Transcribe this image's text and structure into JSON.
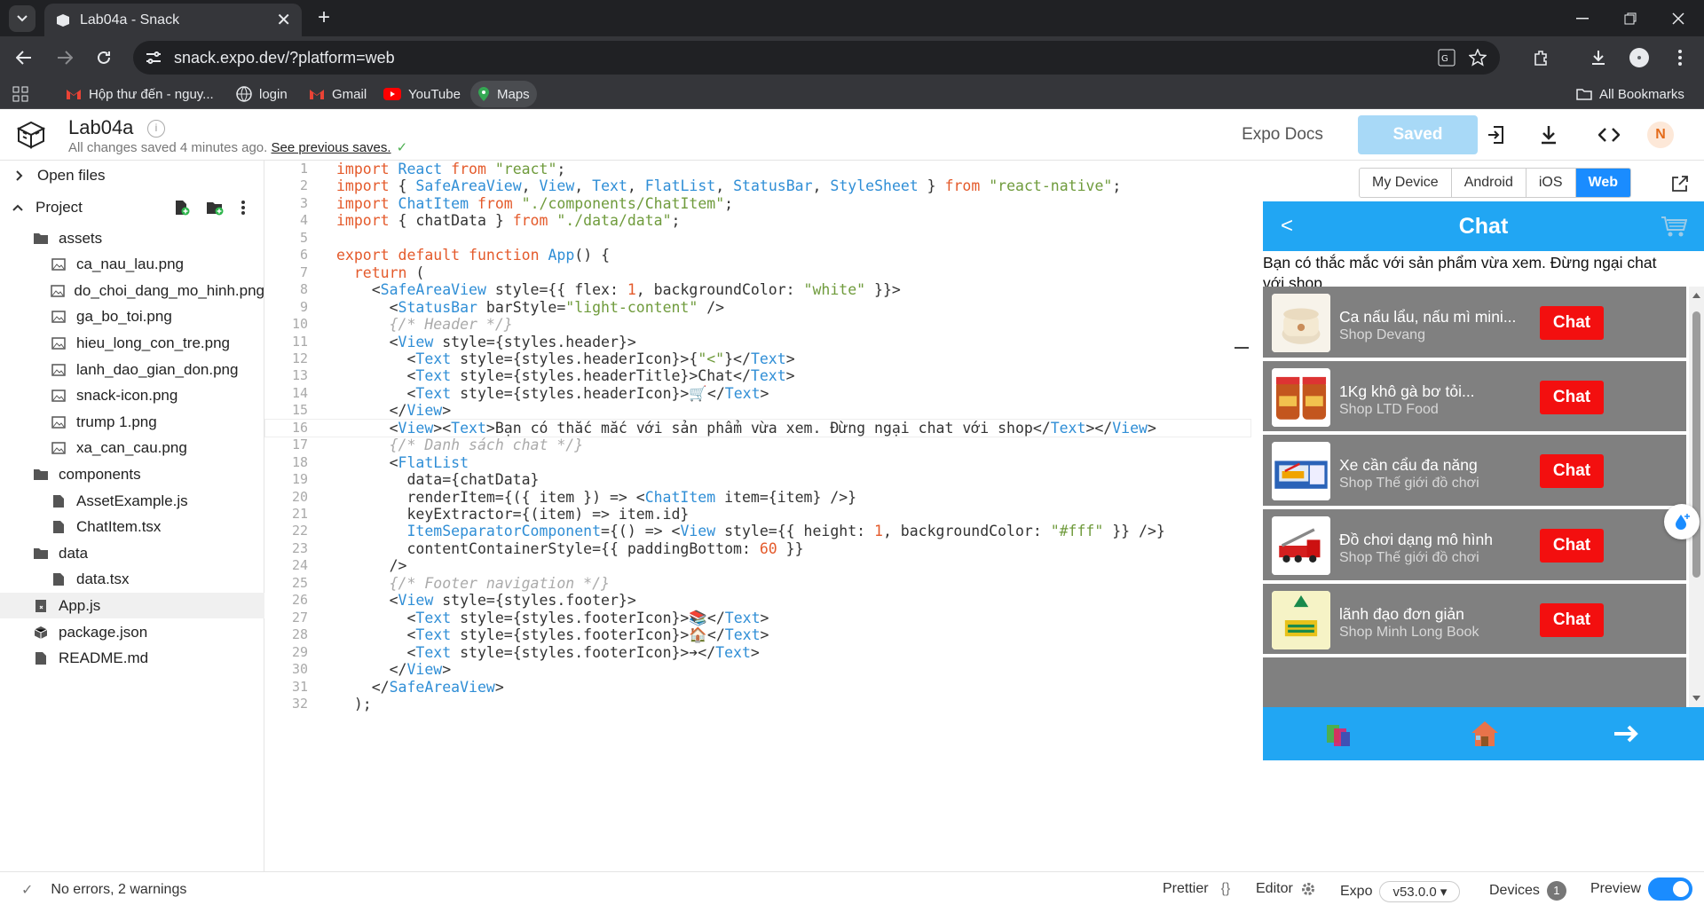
{
  "browser": {
    "tab_title": "Lab04a - Snack",
    "url": "snack.expo.dev/?platform=web",
    "bookmarks": [
      {
        "label": "Hộp thư đến - nguy...",
        "icon": "gmail-icon"
      },
      {
        "label": "login",
        "icon": "globe-icon"
      },
      {
        "label": "Gmail",
        "icon": "gmail-icon"
      },
      {
        "label": "YouTube",
        "icon": "youtube-icon"
      },
      {
        "label": "Maps",
        "icon": "maps-icon"
      }
    ],
    "all_bookmarks": "All Bookmarks"
  },
  "header": {
    "project_name": "Lab04a",
    "save_status": "All changes saved 4 minutes ago.",
    "see_previous": "See previous saves.",
    "expo_docs": "Expo Docs",
    "saved_button": "Saved",
    "avatar_initial": "N"
  },
  "sidebar": {
    "open_files": "Open files",
    "project": "Project",
    "items": [
      {
        "label": "assets",
        "type": "folder",
        "depth": 1
      },
      {
        "label": "ca_nau_lau.png",
        "type": "image",
        "depth": 2
      },
      {
        "label": "do_choi_dang_mo_hinh.png",
        "type": "image",
        "depth": 2
      },
      {
        "label": "ga_bo_toi.png",
        "type": "image",
        "depth": 2
      },
      {
        "label": "hieu_long_con_tre.png",
        "type": "image",
        "depth": 2
      },
      {
        "label": "lanh_dao_gian_don.png",
        "type": "image",
        "depth": 2
      },
      {
        "label": "snack-icon.png",
        "type": "image",
        "depth": 2
      },
      {
        "label": "trump 1.png",
        "type": "image",
        "depth": 2
      },
      {
        "label": "xa_can_cau.png",
        "type": "image",
        "depth": 2
      },
      {
        "label": "components",
        "type": "folder",
        "depth": 1
      },
      {
        "label": "AssetExample.js",
        "type": "file",
        "depth": 2
      },
      {
        "label": "ChatItem.tsx",
        "type": "file",
        "depth": 2
      },
      {
        "label": "data",
        "type": "folder",
        "depth": 1
      },
      {
        "label": "data.tsx",
        "type": "file",
        "depth": 2
      },
      {
        "label": "App.js",
        "type": "js",
        "depth": 1
      },
      {
        "label": "package.json",
        "type": "pkg",
        "depth": 1
      },
      {
        "label": "README.md",
        "type": "file",
        "depth": 1
      }
    ]
  },
  "editor": {
    "line_numbers": [
      "1",
      "2",
      "3",
      "4",
      "5",
      "6",
      "7",
      "8",
      "9",
      "10",
      "11",
      "12",
      "13",
      "14",
      "15",
      "16",
      "17",
      "18",
      "19",
      "20",
      "21",
      "22",
      "23",
      "24",
      "25",
      "26",
      "27",
      "28",
      "29",
      "30",
      "31",
      "32"
    ],
    "lines": [
      "import React from \"react\";",
      "import { SafeAreaView, View, Text, FlatList, StatusBar, StyleSheet } from \"react-native\";",
      "import ChatItem from \"./components/ChatItem\";",
      "import { chatData } from \"./data/data\";",
      "",
      "export default function App() {",
      "  return (",
      "    <SafeAreaView style={{ flex: 1, backgroundColor: \"white\" }}>",
      "      <StatusBar barStyle=\"light-content\" />",
      "      {/* Header */}",
      "      <View style={styles.header}>",
      "        <Text style={styles.headerIcon}>{\"<\"}</Text>",
      "        <Text style={styles.headerTitle}>Chat</Text>",
      "        <Text style={styles.headerIcon}>🛒</Text>",
      "      </View>",
      "      <View><Text>Bạn có thắc mắc với sản phẩm vừa xem. Đừng ngại chat với shop</Text></View>",
      "      {/* Danh sách chat */}",
      "      <FlatList",
      "        data={chatData}",
      "        renderItem={({ item }) => <ChatItem item={item} />}",
      "        keyExtractor={(item) => item.id}",
      "        ItemSeparatorComponent={() => <View style={{ height: 1, backgroundColor: \"#fff\" }} />}",
      "        contentContainerStyle={{ paddingBottom: 60 }}",
      "      />",
      "      {/* Footer navigation */}",
      "      <View style={styles.footer}>",
      "        <Text style={styles.footerIcon}>📚</Text>",
      "        <Text style={styles.footerIcon}>🏠</Text>",
      "        <Text style={styles.footerIcon}>➔</Text>",
      "      </View>",
      "    </SafeAreaView>",
      "  );"
    ]
  },
  "preview": {
    "tabs": [
      "My Device",
      "Android",
      "iOS",
      "Web"
    ],
    "active_tab": "Web",
    "app": {
      "back": "<",
      "title": "Chat",
      "message": "Bạn có thắc mắc với sản phẩm vừa xem. Đừng ngại chat với shop",
      "chat_label": "Chat",
      "items": [
        {
          "name": "Ca nấu lẩu, nấu mì mini...",
          "shop": "Shop Devang",
          "thumb": "pot"
        },
        {
          "name": "1Kg khô gà bơ tỏi...",
          "shop": "Shop LTD Food",
          "thumb": "jars"
        },
        {
          "name": "Xe cần cẩu đa năng",
          "shop": "Shop Thế giới đồ chơi",
          "thumb": "crane"
        },
        {
          "name": "Đồ chơi dạng mô hình",
          "shop": "Shop Thế giới đồ chơi",
          "thumb": "firetruck"
        },
        {
          "name": "lãnh đạo đơn giản",
          "shop": "Shop Minh Long Book",
          "thumb": "book"
        }
      ]
    }
  },
  "statusbar": {
    "errors": "No errors, 2 warnings",
    "prettier": "Prettier",
    "editor": "Editor",
    "expo": "Expo",
    "version": "v53.0.0 ▾",
    "devices": "Devices",
    "devices_count": "1",
    "preview": "Preview"
  },
  "colors": {
    "accent": "#1a8cff",
    "app_header": "#21a6f3",
    "chat_button": "#f30f0f",
    "list_bg": "#808080"
  }
}
